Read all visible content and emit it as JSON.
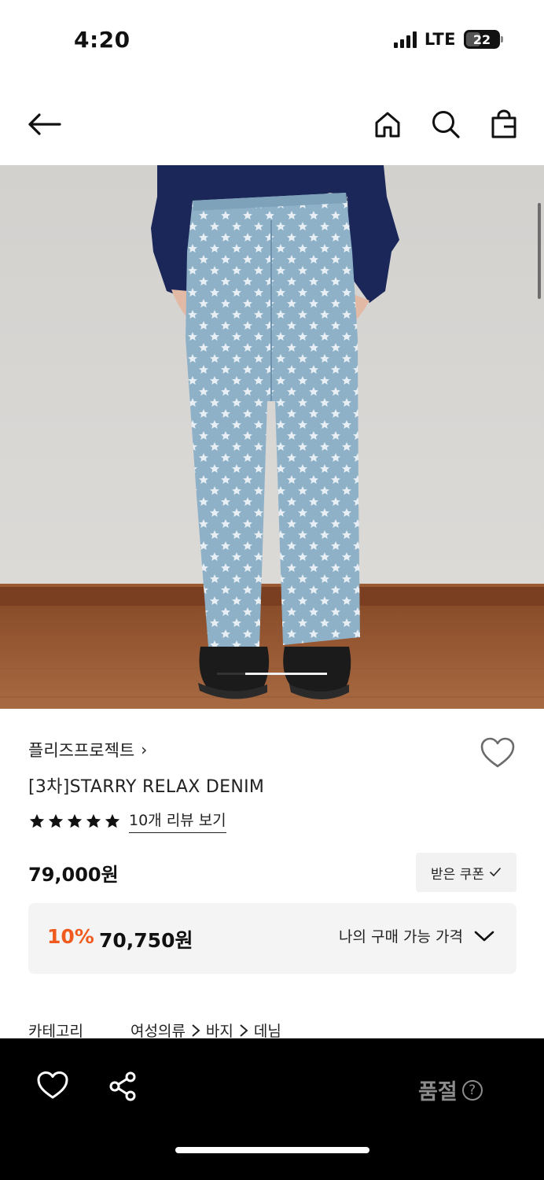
{
  "status_bar": {
    "time": "4:20",
    "network": "LTE",
    "battery": "22",
    "icons": [
      "signal-icon",
      "battery-icon"
    ]
  },
  "nav": {
    "icons": [
      "back-arrow-icon",
      "home-icon",
      "search-icon",
      "shopping-bag-icon"
    ]
  },
  "product": {
    "brand": "플리즈프로젝트",
    "brand_chevron": "›",
    "title": "[3차]STARRY RELAX DENIM",
    "rating_stars": 5,
    "review_link": "10개 리뷰 보기",
    "price": "79,000원",
    "coupon_button": "받은 쿠폰",
    "discount_percent": "10%",
    "discount_price": "70,750원",
    "my_price_label": "나의 구매 가능 가격",
    "category_label": "카테고리",
    "category_path": [
      "여성의류",
      "바지",
      "데님"
    ],
    "image_icon": "denim-star-jeans-photo"
  },
  "bottom_bar": {
    "soldout_label": "품절",
    "help_glyph": "?",
    "icons": [
      "heart-icon",
      "share-icon",
      "help-icon"
    ]
  },
  "colors": {
    "accent_discount": "#f05a1e",
    "bottom_bar_bg": "#000000",
    "soldout_text": "#8c8c8c",
    "price_box_bg": "#f4f4f4"
  }
}
